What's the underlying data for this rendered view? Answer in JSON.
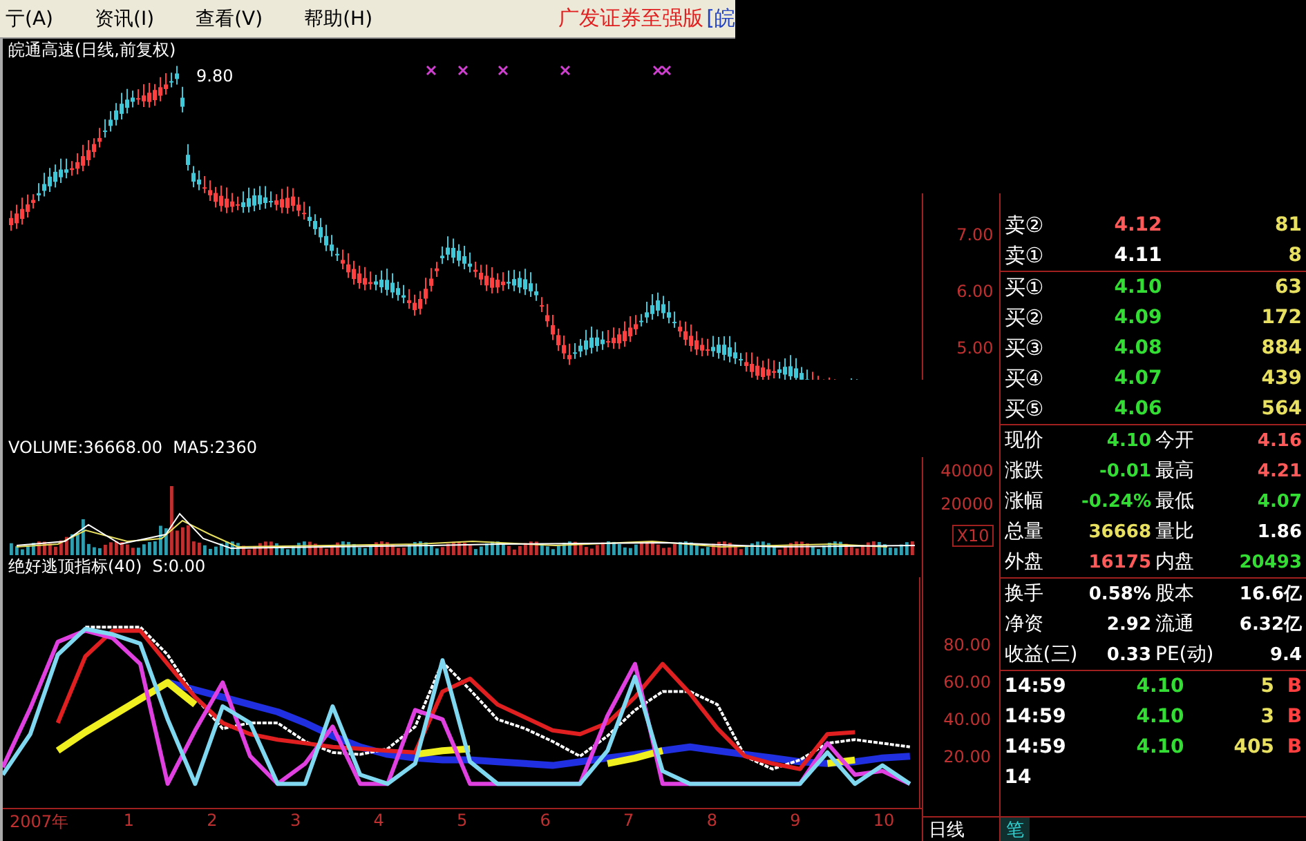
{
  "menu": {
    "items": [
      "亍(A)",
      "资讯(I)",
      "查看(V)",
      "帮助(H)"
    ],
    "brand": "广发证券至强版",
    "brand_suffix": "[皖"
  },
  "price_chart": {
    "title": "皖通高速(日线,前复权)",
    "high_label": "9.80",
    "axis": [
      "7.00",
      "6.00",
      "5.00"
    ]
  },
  "volume_chart": {
    "title": "VOLUME:36668.00  MA5:2360",
    "axis": [
      "40000",
      "20000"
    ],
    "scale": "X10"
  },
  "indicator_chart": {
    "year_label": "2007年",
    "chart_data": {
      "type": "line",
      "title": "绝好逃顶指标(40)  S:0.00",
      "x": [
        -0.5,
        -0.17,
        0.16,
        0.49,
        0.82,
        1.15,
        1.48,
        1.81,
        2.14,
        2.47,
        2.8,
        3.13,
        3.46,
        3.79,
        4.12,
        4.45,
        4.78,
        5.11,
        5.44,
        5.77,
        6.1,
        6.43,
        6.76,
        7.09,
        7.42,
        7.75,
        8.08,
        8.41,
        8.74,
        9.07,
        9.4,
        9.73,
        10.06,
        10.39
      ],
      "xlim": [
        -0.5,
        10.5
      ],
      "xticks": [
        1,
        2,
        3,
        4,
        5,
        6,
        7,
        8,
        9,
        10
      ],
      "ylim": [
        -8,
        117
      ],
      "yticks": [
        {
          "value": 80,
          "label": "80.00"
        },
        {
          "value": 60,
          "label": "60.00"
        },
        {
          "value": 40,
          "label": "40.00"
        },
        {
          "value": 20,
          "label": "20.00"
        }
      ],
      "series": [
        {
          "color": "#2030e0",
          "values": [
            null,
            null,
            null,
            null,
            null,
            null,
            60,
            56,
            52,
            48,
            44,
            38,
            31,
            25,
            21,
            19,
            18,
            18,
            17,
            16,
            15,
            17,
            19,
            21,
            23,
            25,
            23,
            21,
            19,
            17,
            16,
            17,
            19,
            20
          ]
        },
        {
          "color": "#f0f020",
          "values": [
            null,
            null,
            23,
            33,
            42,
            51,
            60,
            48,
            null,
            null,
            null,
            null,
            null,
            null,
            null,
            21,
            23,
            24,
            null,
            null,
            null,
            null,
            16,
            19,
            23,
            null,
            null,
            null,
            null,
            null,
            16,
            18,
            null,
            null
          ]
        },
        {
          "color": "#ffffff",
          "line_style": "dashed",
          "values": [
            null,
            null,
            null,
            90,
            90,
            90,
            75,
            52,
            35,
            38,
            38,
            28,
            22,
            21,
            24,
            36,
            71,
            56,
            40,
            35,
            28,
            20,
            31,
            45,
            55,
            55,
            48,
            20,
            13,
            18,
            27,
            29,
            27,
            25
          ]
        },
        {
          "color": "#e02020",
          "values": [
            null,
            null,
            38,
            74,
            88,
            88,
            70,
            52,
            38,
            32,
            29,
            27,
            25,
            24,
            23,
            22,
            55,
            62,
            48,
            41,
            34,
            32,
            38,
            52,
            70,
            54,
            35,
            20,
            16,
            13,
            32,
            33,
            null,
            null
          ]
        },
        {
          "color": "#e040e0",
          "values": [
            14,
            46,
            82,
            88,
            84,
            70,
            5,
            34,
            60,
            20,
            5,
            16,
            36,
            5,
            5,
            45,
            40,
            5,
            5,
            5,
            5,
            5,
            42,
            70,
            5,
            5,
            5,
            5,
            5,
            5,
            27,
            10,
            12,
            5
          ]
        },
        {
          "color": "#80d8f0",
          "values": [
            10,
            32,
            75,
            89,
            86,
            81,
            40,
            5,
            47,
            38,
            5,
            5,
            47,
            10,
            5,
            16,
            72,
            17,
            5,
            5,
            5,
            5,
            23,
            63,
            12,
            5,
            5,
            5,
            5,
            5,
            22,
            5,
            15,
            5
          ]
        }
      ]
    }
  },
  "bottom_tabs": [
    {
      "label": "日线",
      "selected": false
    },
    {
      "label": "笔",
      "selected": true
    }
  ],
  "order_book": [
    {
      "label": "卖②",
      "price": "4.12",
      "volume": "81",
      "color": "#ff5a5a"
    },
    {
      "label": "卖①",
      "price": "4.11",
      "volume": "8",
      "color": "#ffffff"
    },
    {
      "label": "买①",
      "price": "4.10",
      "volume": "63",
      "color": "#33dd33"
    },
    {
      "label": "买②",
      "price": "4.09",
      "volume": "172",
      "color": "#33dd33"
    },
    {
      "label": "买③",
      "price": "4.08",
      "volume": "884",
      "color": "#33dd33"
    },
    {
      "label": "买④",
      "price": "4.07",
      "volume": "439",
      "color": "#33dd33"
    },
    {
      "label": "买⑤",
      "price": "4.06",
      "volume": "564",
      "color": "#33dd33"
    }
  ],
  "quote_groups": [
    [
      [
        {
          "label": "现价",
          "value": "4.10",
          "color": "#33dd33"
        },
        {
          "label": "今开",
          "value": "4.16",
          "color": "#ff5a5a"
        }
      ],
      [
        {
          "label": "涨跌",
          "value": "-0.01",
          "color": "#33dd33"
        },
        {
          "label": "最高",
          "value": "4.21",
          "color": "#ff5a5a"
        }
      ],
      [
        {
          "label": "涨幅",
          "value": "-0.24%",
          "color": "#33dd33"
        },
        {
          "label": "最低",
          "value": "4.07",
          "color": "#33dd33"
        }
      ],
      [
        {
          "label": "总量",
          "value": "36668",
          "color": "#e8e060"
        },
        {
          "label": "量比",
          "value": "1.86",
          "color": "#ffffff"
        }
      ],
      [
        {
          "label": "外盘",
          "value": "16175",
          "color": "#ff5a5a"
        },
        {
          "label": "内盘",
          "value": "20493",
          "color": "#33dd33"
        }
      ]
    ],
    [
      [
        {
          "label": "换手",
          "value": "0.58%",
          "color": "#ffffff"
        },
        {
          "label": "股本",
          "value": "16.6亿",
          "color": "#ffffff"
        }
      ],
      [
        {
          "label": "净资",
          "value": "2.92",
          "color": "#ffffff"
        },
        {
          "label": "流通",
          "value": "6.32亿",
          "color": "#ffffff"
        }
      ],
      [
        {
          "label": "收益(三)",
          "value": "0.33",
          "color": "#ffffff"
        },
        {
          "label": "PE(动)",
          "value": "9.4",
          "color": "#ffffff"
        }
      ]
    ]
  ],
  "trades": [
    {
      "time": "14:59",
      "price": "4.10",
      "volume": "5",
      "side": "B"
    },
    {
      "time": "14:59",
      "price": "4.10",
      "volume": "3",
      "side": "B"
    },
    {
      "time": "14:59",
      "price": "4.10",
      "volume": "405",
      "side": "B"
    },
    {
      "time": "14"
    }
  ]
}
